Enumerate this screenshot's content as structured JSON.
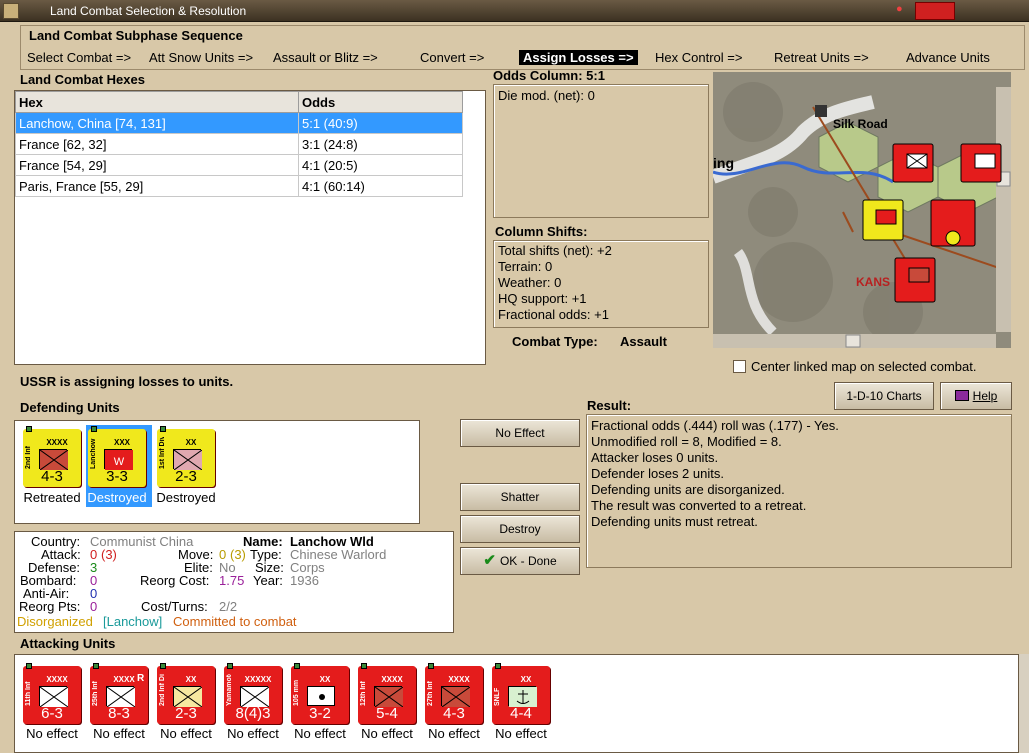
{
  "window": {
    "title": "Land Combat Selection & Resolution"
  },
  "subphase": {
    "heading": "Land Combat Subphase Sequence",
    "steps": [
      "Select Combat =>",
      "Att Snow Units =>",
      "Assault or Blitz =>",
      "Convert =>",
      "Assign Losses =>",
      "Hex Control =>",
      "Retreat Units =>",
      "Advance Units"
    ],
    "active_index": 4
  },
  "hexes": {
    "heading": "Land Combat Hexes",
    "col_hex": "Hex",
    "col_odds": "Odds",
    "rows": [
      {
        "hex": "Lanchow, China [74, 131]",
        "odds": "5:1 (40:9)"
      },
      {
        "hex": "France [62, 32]",
        "odds": "3:1 (24:8)"
      },
      {
        "hex": "France [54, 29]",
        "odds": "4:1 (20:5)"
      },
      {
        "hex": "Paris, France [55, 29]",
        "odds": "4:1 (60:14)"
      }
    ]
  },
  "odds": {
    "heading": "Odds Column: 5:1",
    "die_mod": "Die mod. (net): 0"
  },
  "shifts": {
    "heading": "Column Shifts:",
    "lines": [
      "Total shifts (net): +2",
      "Terrain: 0",
      "Weather: 0",
      "HQ support: +1",
      "Fractional odds: +1"
    ]
  },
  "combat_type": {
    "label": "Combat Type:",
    "value": "Assault"
  },
  "map": {
    "labels": {
      "silk_road": "Silk Road",
      "town": "ing",
      "kans": "KANS"
    },
    "center_check_label": "Center linked map on selected combat."
  },
  "status": "USSR is assigning losses to units.",
  "defending": {
    "heading": "Defending Units",
    "units": [
      {
        "name": "2nd Inf",
        "size": "XXXX",
        "strength": "4-3",
        "color": "yellow",
        "label": "Retreated",
        "selected": false
      },
      {
        "name": "Lanchow Wld",
        "size": "XXX",
        "strength": "3-3",
        "color": "yellow",
        "label": "Destroyed",
        "selected": true,
        "mark": "W"
      },
      {
        "name": "1st Inf Div",
        "size": "XX",
        "strength": "2-3",
        "color": "yellow",
        "label": "Destroyed",
        "selected": false
      }
    ]
  },
  "buttons": {
    "no_effect": "No Effect",
    "shatter": "Shatter",
    "destroy": "Destroy",
    "ok": "OK - Done",
    "charts": "1-D-10 Charts",
    "help": "Help"
  },
  "info": {
    "country_l": "Country:",
    "country_v": "Communist China",
    "name_l": "Name:",
    "name_v": "Lanchow Wld",
    "attack_l": "Attack:",
    "attack_v": "0",
    "attack_v2": "(3)",
    "move_l": "Move:",
    "move_v": "0",
    "move_v2": "(3)",
    "type_l": "Type:",
    "type_v": "Chinese Warlord",
    "defense_l": "Defense:",
    "defense_v": "3",
    "elite_l": "Elite:",
    "elite_v": "No",
    "size_l": "Size:",
    "size_v": "Corps",
    "bombard_l": "Bombard:",
    "bombard_v": "0",
    "reorg_l": "Reorg Cost:",
    "reorg_v": "1.75",
    "year_l": "Year:",
    "year_v": "1936",
    "antiair_l": "Anti-Air:",
    "antiair_v": "0",
    "reorgpts_l": "Reorg Pts:",
    "reorgpts_v": "0",
    "cost_l": "Cost/Turns:",
    "cost_v": "2/2",
    "disorg": "Disorganized",
    "loc": "[Lanchow]",
    "committed": "Committed to combat"
  },
  "result": {
    "heading": "Result:",
    "lines": [
      "Fractional odds (.444) roll was (.177)  - Yes.",
      "Unmodified roll = 8, Modified = 8.",
      "Attacker loses 0 units.",
      "Defender loses 2 units.",
      "Defending units are disorganized.",
      "The result was converted to a retreat.",
      "Defending units must retreat."
    ]
  },
  "attacking": {
    "heading": "Attacking Units",
    "units": [
      {
        "name": "11th Inf",
        "size": "XXXX",
        "strength": "6-3",
        "label": "No effect",
        "sym": "inf"
      },
      {
        "name": "25th Inf",
        "size": "XXXX",
        "strength": "8-3",
        "label": "No effect",
        "sym": "inf",
        "tag": "R"
      },
      {
        "name": "2nd Inf Div",
        "size": "XX",
        "strength": "2-3",
        "label": "No effect",
        "sym": "inf-y"
      },
      {
        "name": "Yamamoto",
        "size": "XXXXX",
        "strength": "8(4)3",
        "label": "No effect",
        "sym": "inf"
      },
      {
        "name": "105 mm",
        "size": "XX",
        "strength": "3-2",
        "label": "No effect",
        "sym": "art"
      },
      {
        "name": "12th Inf",
        "size": "XXXX",
        "strength": "5-4",
        "label": "No effect",
        "sym": "inf-r"
      },
      {
        "name": "27th Inf",
        "size": "XXXX",
        "strength": "4-3",
        "label": "No effect",
        "sym": "inf-r"
      },
      {
        "name": "SNLF",
        "size": "XX",
        "strength": "4-4",
        "label": "No effect",
        "sym": "mar"
      }
    ]
  }
}
